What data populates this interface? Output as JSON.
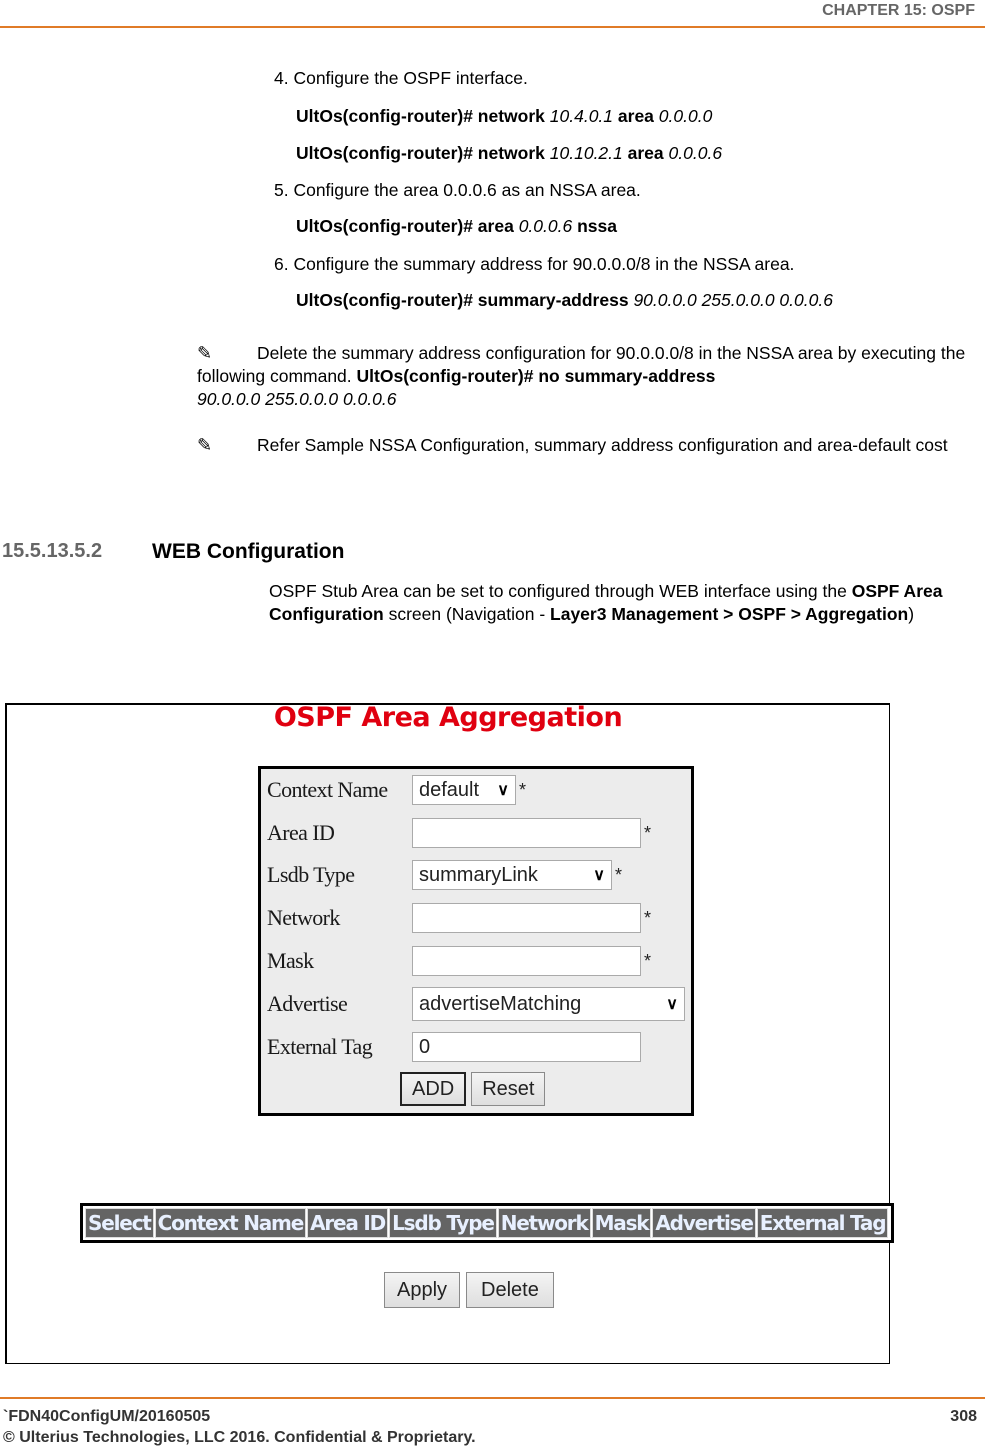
{
  "header": {
    "chapter": "CHAPTER 15: OSPF"
  },
  "steps": [
    {
      "text": "4. Configure the OSPF interface."
    },
    {
      "text": "5. Configure the area 0.0.0.6 as an NSSA area."
    },
    {
      "text": "6. Configure the summary address for 90.0.0.0/8 in the NSSA area."
    }
  ],
  "commands": [
    {
      "prompt": "UltOs(config-router)# network",
      "arg1": "10.4.0.1",
      "kw2": "area",
      "arg2": "0.0.0.0"
    },
    {
      "prompt": "UltOs(config-router)# network",
      "arg1": "10.10.2.1",
      "kw2": "area",
      "arg2": "0.0.0.6"
    },
    {
      "prompt": "UltOs(config-router)# area",
      "arg1": "0.0.0.6",
      "kw2": "nssa",
      "arg2": ""
    },
    {
      "prompt": "UltOs(config-router)# summary-address",
      "arg1": "90.0.0.0 255.0.0.0 0.0.0.6",
      "kw2": "",
      "arg2": ""
    }
  ],
  "notes": [
    {
      "icon": "pencil-icon",
      "text": "Delete the summary address configuration for 90.0.0.0/8 in the NSSA area by executing the following command. ",
      "bold": "UltOs(config-router)# no summary-address",
      "italic": "90.0.0.0 255.0.0.0 0.0.0.6"
    },
    {
      "icon": "pencil-icon",
      "text": "Refer Sample NSSA Configuration, summary address configuration and area-default cost"
    }
  ],
  "section": {
    "number": "15.5.13.5.2",
    "title": "WEB Configuration",
    "body_1": "OSPF Stub Area can be set to configured through WEB interface using the ",
    "body_bold_1": "OSPF Area Configuration",
    "body_2": " screen (Navigation - ",
    "body_bold_2": "Layer3 Management > OSPF  >  Aggregation",
    "body_3": ")"
  },
  "ui": {
    "title": "OSPF Area Aggregation",
    "fields": {
      "context_name": {
        "label": "Context Name",
        "value": "default",
        "required": "*"
      },
      "area_id": {
        "label": "Area ID",
        "value": "",
        "required": "*"
      },
      "lsdb_type": {
        "label": "Lsdb Type",
        "value": "summaryLink",
        "required": "*"
      },
      "network": {
        "label": "Network",
        "value": "",
        "required": "*"
      },
      "mask": {
        "label": "Mask",
        "value": "",
        "required": "*"
      },
      "advertise": {
        "label": "Advertise",
        "value": "advertiseMatching"
      },
      "external_tag": {
        "label": "External Tag",
        "value": "0"
      }
    },
    "add_label": "ADD",
    "reset_label": "Reset",
    "table_headers": [
      "Select",
      "Context Name",
      "Area ID",
      "Lsdb Type",
      "Network",
      "Mask",
      "Advertise",
      "External Tag"
    ],
    "apply_label": "Apply",
    "delete_label": "Delete"
  },
  "footer": {
    "doc_id": "`FDN40ConfigUM/20160505",
    "copyright": "© Ulterius Technologies, LLC 2016. Confidential & Proprietary.",
    "page": "308"
  }
}
